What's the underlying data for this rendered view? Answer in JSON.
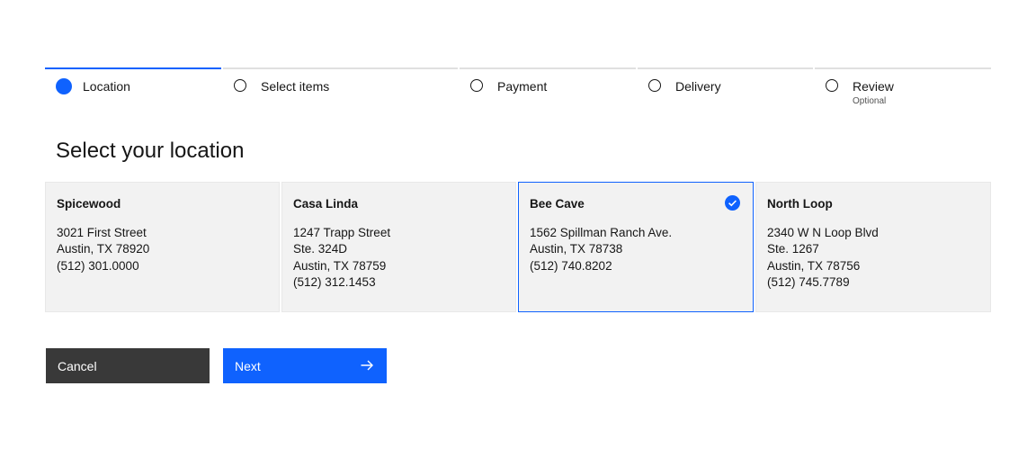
{
  "progress": {
    "steps": [
      {
        "label": "Location",
        "sub": "",
        "state": "current"
      },
      {
        "label": "Select items",
        "sub": "",
        "state": "incomplete"
      },
      {
        "label": "Payment",
        "sub": "",
        "state": "incomplete"
      },
      {
        "label": "Delivery",
        "sub": "",
        "state": "incomplete"
      },
      {
        "label": "Review",
        "sub": "Optional",
        "state": "incomplete"
      }
    ]
  },
  "page": {
    "title": "Select your location"
  },
  "tiles": [
    {
      "name": "Spicewood",
      "lines": [
        "3021 First Street",
        "Austin, TX 78920",
        "(512) 301.0000"
      ],
      "selected": false
    },
    {
      "name": "Casa Linda",
      "lines": [
        "1247 Trapp Street",
        "Ste. 324D",
        "Austin, TX 78759",
        "(512) 312.1453"
      ],
      "selected": false
    },
    {
      "name": "Bee Cave",
      "lines": [
        "1562 Spillman Ranch Ave.",
        "Austin, TX 78738",
        "(512) 740.8202"
      ],
      "selected": true
    },
    {
      "name": "North Loop",
      "lines": [
        "2340 W N Loop Blvd",
        "Ste. 1267",
        "Austin, TX 78756",
        "(512) 745.7789"
      ],
      "selected": false
    }
  ],
  "actions": {
    "cancel_label": "Cancel",
    "next_label": "Next"
  },
  "icons": {
    "check": "checkmark-filled-icon",
    "next": "arrow-right-icon"
  },
  "colors": {
    "accent": "#0f62fe",
    "secondary_button": "#393939",
    "tile_background": "#f2f2f2",
    "step_track": "#e0e0e0",
    "text": "#161616"
  }
}
